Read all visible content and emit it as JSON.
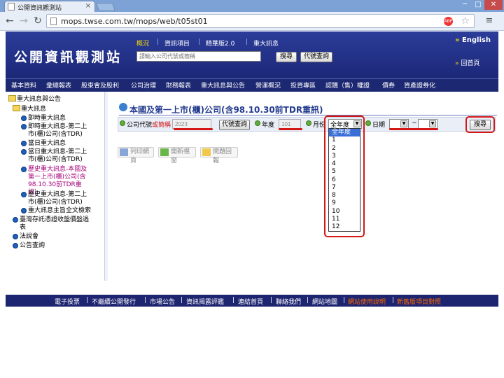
{
  "browser": {
    "tab_title": "公開資訊觀測站",
    "url": "mops.twse.com.tw/mops/web/t05st01",
    "tab_close": "×",
    "win_min": "─",
    "win_max": "□",
    "win_close": "✕",
    "adblock_badge": "ABP"
  },
  "header": {
    "logo_text": "公開資訊觀測站",
    "top_links": [
      "概況",
      "資訊項目",
      "精華版2.0",
      "重大訊息"
    ],
    "search_placeholder": "請輸入公司代號或簡稱",
    "search_btn": "搜尋",
    "code_btn": "代號查詢",
    "english": "English",
    "home": "回首頁"
  },
  "main_nav": [
    "基本資料",
    "彙總報表",
    "股東會及股利",
    "公司治理",
    "財務報表",
    "重大訊息與公告",
    "營運概況",
    "投資專區",
    "認購（售）權證",
    "債券",
    "資產證券化"
  ],
  "sidebar": {
    "root": "重大訊息與公告",
    "group": "重大訊息",
    "items": [
      {
        "label": "即時重大訊息",
        "active": false
      },
      {
        "label": "即時重大訊息-第二上市(櫃)公司(含TDR)",
        "active": false
      },
      {
        "label": "當日重大訊息",
        "active": false
      },
      {
        "label": "當日重大訊息-第二上市(櫃)公司(含TDR)",
        "active": false
      },
      {
        "label": "歷史重大訊息-本國及第一上市(櫃)公司(含98.10.30前TDR重訊)",
        "active": true
      },
      {
        "label": "歷史重大訊息-第二上市(櫃)公司(含TDR)",
        "active": false
      },
      {
        "label": "重大訊息主旨全文檢索",
        "active": false
      }
    ],
    "other": [
      "臺灣存託憑證收盤價盤過表",
      "法說會",
      "公告查詢"
    ]
  },
  "content": {
    "title": "本國及第一上市(櫃)公司(含98.10.30前TDR重訊)",
    "company_label_a": "公司代號",
    "company_label_b": "或簡稱",
    "company_value": "2023",
    "code_query_btn": "代號查詢",
    "year_label": "年度",
    "year_value": "101",
    "month_label": "月份",
    "month_selected": "全年度",
    "month_options": [
      "全年度",
      "1",
      "2",
      "3",
      "4",
      "5",
      "6",
      "7",
      "8",
      "9",
      "10",
      "11",
      "12"
    ],
    "date_label": "日期",
    "date_sep": "~",
    "search_btn": "搜尋",
    "tools": [
      "列印網頁",
      "開新視窗",
      "問題回報"
    ]
  },
  "footer": [
    "電子投票",
    "不繼續公開發行",
    "市場公告",
    "資訊揭露評鑑",
    "連結首頁",
    "聯絡我們",
    "網站地圖",
    "網站使用說明",
    "新舊版項目對照"
  ],
  "colors": {
    "header": "#23318a",
    "nav": "#1c2872",
    "active": "#a40079",
    "highlight": "#d31717",
    "footer_accent": "#ff6a00"
  }
}
